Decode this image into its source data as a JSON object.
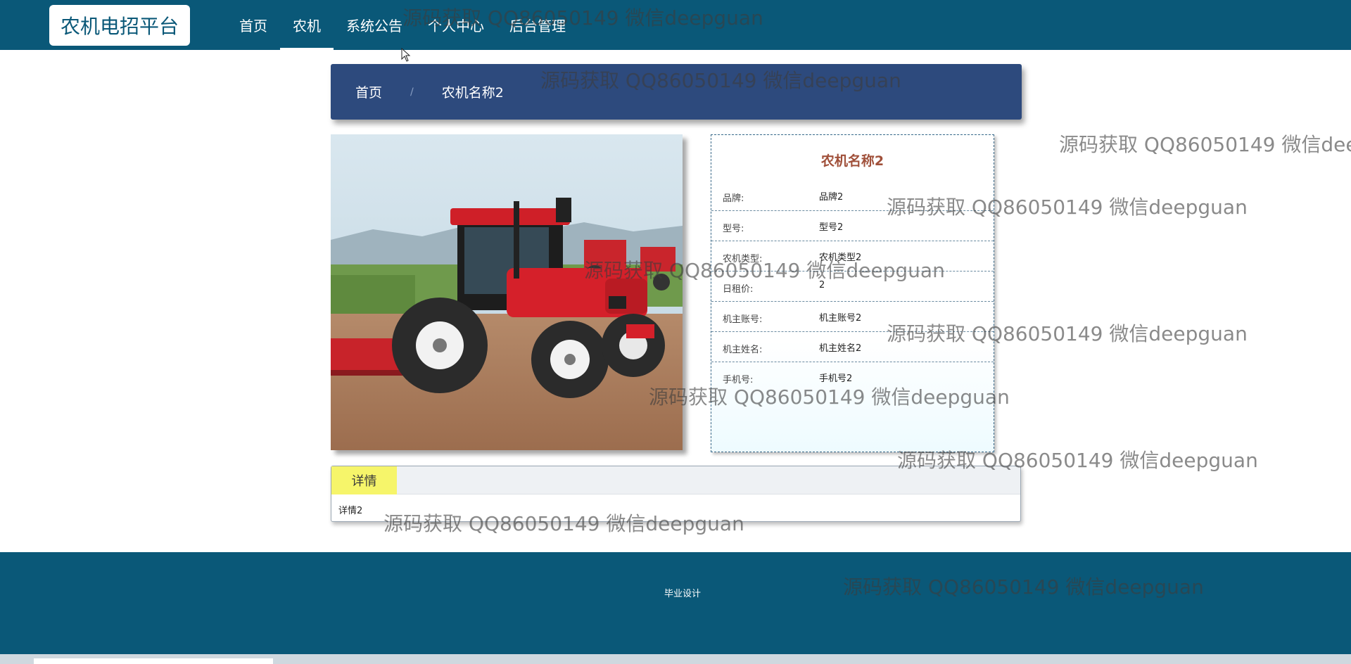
{
  "app": {
    "logo_text": "农机电招平台"
  },
  "nav": {
    "items": [
      {
        "label": "首页",
        "active": false
      },
      {
        "label": "农机",
        "active": true
      },
      {
        "label": "系统公告",
        "active": false
      },
      {
        "label": "个人中心",
        "active": false
      },
      {
        "label": "后台管理",
        "active": false
      }
    ]
  },
  "breadcrumb": {
    "items": [
      "首页",
      "农机名称2"
    ],
    "separator": "/"
  },
  "product": {
    "name": "农机名称2",
    "image_icon": "tractor-photo",
    "fields": [
      {
        "label": "品牌:",
        "value": "品牌2"
      },
      {
        "label": "型号:",
        "value": "型号2"
      },
      {
        "label": "农机类型:",
        "value": "农机类型2"
      },
      {
        "label": "日租价:",
        "value": "2"
      },
      {
        "label": "机主账号:",
        "value": "机主账号2"
      },
      {
        "label": "机主姓名:",
        "value": "机主姓名2"
      },
      {
        "label": "手机号:",
        "value": "手机号2"
      }
    ]
  },
  "detail": {
    "tab_label": "详情",
    "content": "详情2"
  },
  "footer": {
    "text": "毕业设计"
  },
  "watermark": {
    "text": "源码获取 QQ86050149 微信deepguan"
  },
  "colors": {
    "primary": "#0a5878",
    "breadcrumb_bg": "#2d4a7d",
    "title": "#a0503a",
    "tab": "#f6f56a"
  }
}
